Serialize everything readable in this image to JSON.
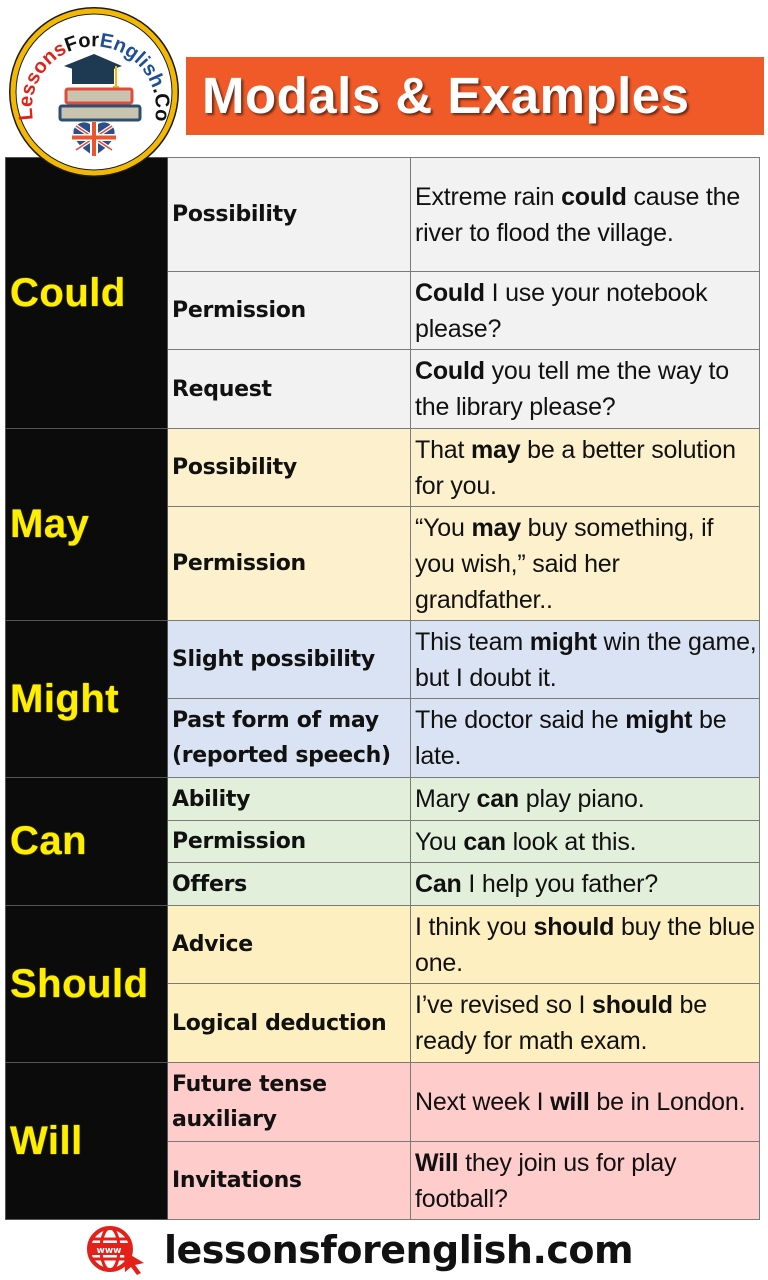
{
  "header": {
    "title": "Modals & Examples",
    "logo": {
      "ring_text": "LessonsForEnglish.Com",
      "icon": "books-graduation-cap-icon",
      "flag": "uk-flag-heart-icon"
    }
  },
  "colors": {
    "banner": "#f05a28",
    "modal_column": "#0b0b0b",
    "modal_text": "#ffee00",
    "could_rows": "#f2f2f2",
    "may_rows": "#fdf0cc",
    "might_rows": "#dae3f3",
    "can_rows": "#e2efda",
    "should_rows": "#fdefc0",
    "will_rows": "#ffcccc",
    "footer_icon": "#e32119"
  },
  "modals": [
    {
      "modal": "Could",
      "rows": [
        {
          "use": "Possibility",
          "example": [
            {
              "t": "Extreme rain "
            },
            {
              "t": "could",
              "b": true
            },
            {
              "t": " cause the river to flood the village."
            }
          ]
        },
        {
          "use": "Permission",
          "example": [
            {
              "t": "Could",
              "b": true
            },
            {
              "t": " I use your notebook please?"
            }
          ]
        },
        {
          "use": "Request",
          "example": [
            {
              "t": "Could",
              "b": true
            },
            {
              "t": " you tell me the way to the library please?"
            }
          ]
        }
      ]
    },
    {
      "modal": "May",
      "rows": [
        {
          "use": "Possibility",
          "example": [
            {
              "t": "That "
            },
            {
              "t": "may",
              "b": true
            },
            {
              "t": " be a better solution for you."
            }
          ]
        },
        {
          "use": "Permission",
          "example": [
            {
              "t": "“You "
            },
            {
              "t": "may",
              "b": true
            },
            {
              "t": " buy something, if you wish,” said her grandfather.."
            }
          ]
        }
      ]
    },
    {
      "modal": "Might",
      "rows": [
        {
          "use": "Slight possibility",
          "example": [
            {
              "t": "This team "
            },
            {
              "t": "might",
              "b": true
            },
            {
              "t": " win the game, but I doubt it."
            }
          ]
        },
        {
          "use": "Past form of may (reported speech)",
          "example": [
            {
              "t": "The doctor said he "
            },
            {
              "t": "might",
              "b": true
            },
            {
              "t": " be late."
            }
          ]
        }
      ]
    },
    {
      "modal": "Can",
      "rows": [
        {
          "use": "Ability",
          "example": [
            {
              "t": "Mary "
            },
            {
              "t": "can",
              "b": true
            },
            {
              "t": " play piano."
            }
          ]
        },
        {
          "use": "Permission",
          "example": [
            {
              "t": "You "
            },
            {
              "t": "can",
              "b": true
            },
            {
              "t": " look at this."
            }
          ]
        },
        {
          "use": "Offers",
          "example": [
            {
              "t": "Can",
              "b": true
            },
            {
              "t": " I help you father?"
            }
          ]
        }
      ]
    },
    {
      "modal": "Should",
      "rows": [
        {
          "use": "Advice",
          "example": [
            {
              "t": "I think you "
            },
            {
              "t": "should",
              "b": true
            },
            {
              "t": " buy the blue one."
            }
          ]
        },
        {
          "use": "Logical deduction",
          "example": [
            {
              "t": "I’ve revised so I "
            },
            {
              "t": "should",
              "b": true
            },
            {
              "t": " be ready for math exam."
            }
          ]
        }
      ]
    },
    {
      "modal": "Will",
      "rows": [
        {
          "use": "Future tense auxiliary",
          "example": [
            {
              "t": "Next week I "
            },
            {
              "t": "will",
              "b": true
            },
            {
              "t": " be in London."
            }
          ]
        },
        {
          "use": "Invitations",
          "example": [
            {
              "t": "Will",
              "b": true
            },
            {
              "t": " they join us for play football?"
            }
          ]
        }
      ]
    }
  ],
  "footer": {
    "icon": "www-globe-cursor-icon",
    "url": "lessonsforenglish.com"
  }
}
